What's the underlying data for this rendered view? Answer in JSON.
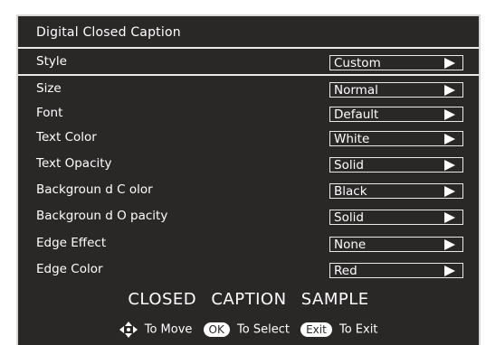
{
  "menu": {
    "title": "Digital Closed Caption",
    "rows": [
      {
        "label": "Style",
        "value": "Custom"
      },
      {
        "label": "Size",
        "value": "Normal"
      },
      {
        "label": "Font",
        "value": "Default"
      },
      {
        "label": "Text Color",
        "value": "White"
      },
      {
        "label": "Text Opacity",
        "value": "Solid"
      },
      {
        "label": "Backgroun d C olor",
        "value": "Black"
      },
      {
        "label": "Backgroun d O pacity",
        "value": "Solid"
      },
      {
        "label": "Edge Effect",
        "value": "None"
      },
      {
        "label": "Edge Color",
        "value": "Red"
      }
    ],
    "sample_text": "CLOSED CAPTION SAMPLE"
  },
  "footer": {
    "move_icon": "four-way-arrow-icon",
    "move_label": "To Move",
    "ok_key": "OK",
    "select_label": "To Select",
    "exit_key": "Exit",
    "exit_label": "To Exit"
  }
}
